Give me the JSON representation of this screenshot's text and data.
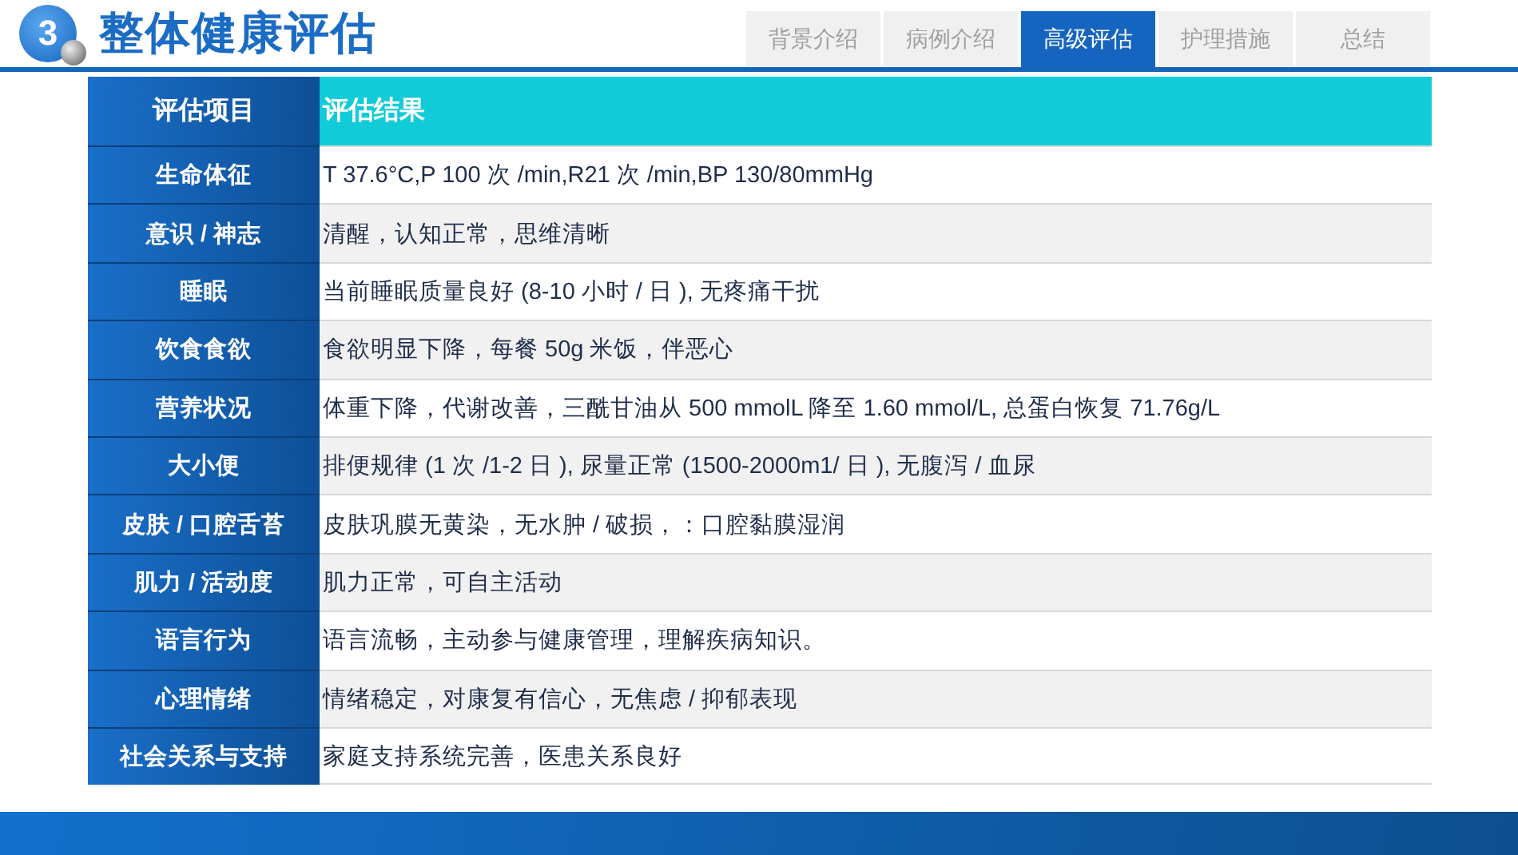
{
  "header": {
    "badge": "3",
    "title": "整体健康评估"
  },
  "tabs": [
    {
      "label": "背景介绍",
      "selected": false
    },
    {
      "label": "病例介绍",
      "selected": false
    },
    {
      "label": "高级评估",
      "selected": true
    },
    {
      "label": "护理措施",
      "selected": false
    },
    {
      "label": "总结",
      "selected": false
    }
  ],
  "table": {
    "columns": [
      "评估项目",
      "评估结果"
    ],
    "rows": [
      {
        "item": "生命体征",
        "result": "T 37.6°C,P 100 次 /min,R21 次 /min,BP 130/80mmHg"
      },
      {
        "item": "意识 / 神志",
        "result": "清醒，认知正常，思维清晰"
      },
      {
        "item": "睡眠",
        "result": "当前睡眠质量良好 (8-10 小时 / 日 ), 无疼痛干扰"
      },
      {
        "item": "饮食食欲",
        "result": "食欲明显下降，每餐 50g 米饭，伴恶心"
      },
      {
        "item": "营养状况",
        "result": "体重下降，代谢改善，三酰甘油从 500 mmolL 降至 1.60 mmol/L, 总蛋白恢复 71.76g/L"
      },
      {
        "item": "大小便",
        "result": "排便规律 (1 次 /1-2 日 ), 尿量正常 (1500-2000m1/ 日 ), 无腹泻 / 血尿"
      },
      {
        "item": "皮肤 / 口腔舌苔",
        "result": "皮肤巩膜无黄染，无水肿 / 破损，：口腔黏膜湿润"
      },
      {
        "item": "肌力 / 活动度",
        "result": "肌力正常，可自主活动"
      },
      {
        "item": "语言行为",
        "result": "语言流畅，主动参与健康管理，理解疾病知识。"
      },
      {
        "item": "心理情绪",
        "result": "情绪稳定，对康复有信心，无焦虑 / 抑郁表现"
      },
      {
        "item": "社会关系与支持",
        "result": "家庭支持系统完善，医患关系良好"
      }
    ]
  }
}
